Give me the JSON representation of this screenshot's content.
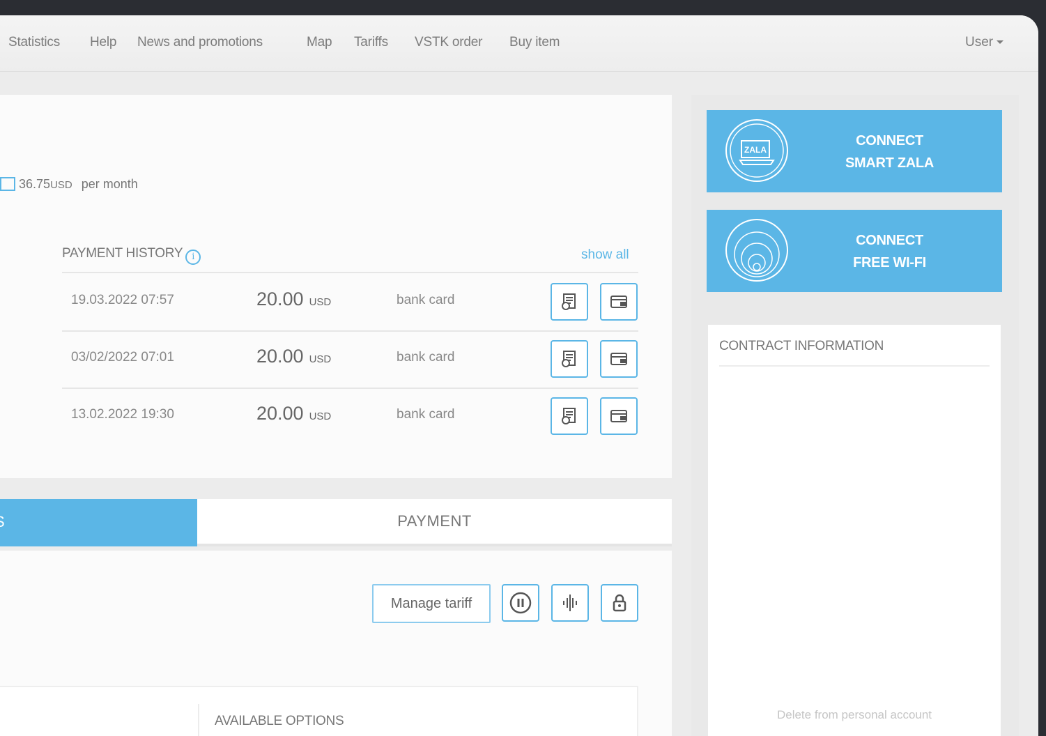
{
  "nav": {
    "items": [
      "Statistics",
      "Help",
      "News and promotions",
      "Map",
      "Tariffs",
      "VSTK order",
      "Buy item"
    ],
    "user_label": "User"
  },
  "tariff": {
    "price": "36.75",
    "currency": "USD",
    "period": "per month"
  },
  "payment_history": {
    "title": "PAYMENT HISTORY",
    "show_all": "show all",
    "rows": [
      {
        "date": "19.03.2022 07:57",
        "amount": "20.00",
        "currency": "USD",
        "method": "bank card"
      },
      {
        "date": "03/02/2022 07:01",
        "amount": "20.00",
        "currency": "USD",
        "method": "bank card"
      },
      {
        "date": "13.02.2022 19:30",
        "amount": "20.00",
        "currency": "USD",
        "method": "bank card"
      }
    ]
  },
  "tabs": {
    "active_label": "S",
    "payment_label": "PAYMENT"
  },
  "actions": {
    "manage_tariff": "Manage tariff"
  },
  "options": {
    "title": "AVAILABLE OPTIONS"
  },
  "promos": [
    {
      "line1": "CONNECT",
      "line2": "SMART ZALA",
      "logo_text": "ZALA"
    },
    {
      "line1": "CONNECT",
      "line2": "FREE WI-FI"
    }
  ],
  "contract": {
    "title": "CONTRACT INFORMATION",
    "delete_link": "Delete from personal account"
  },
  "colors": {
    "accent": "#5bb6e6",
    "background": "#ececec",
    "frame": "#2b2d33"
  }
}
